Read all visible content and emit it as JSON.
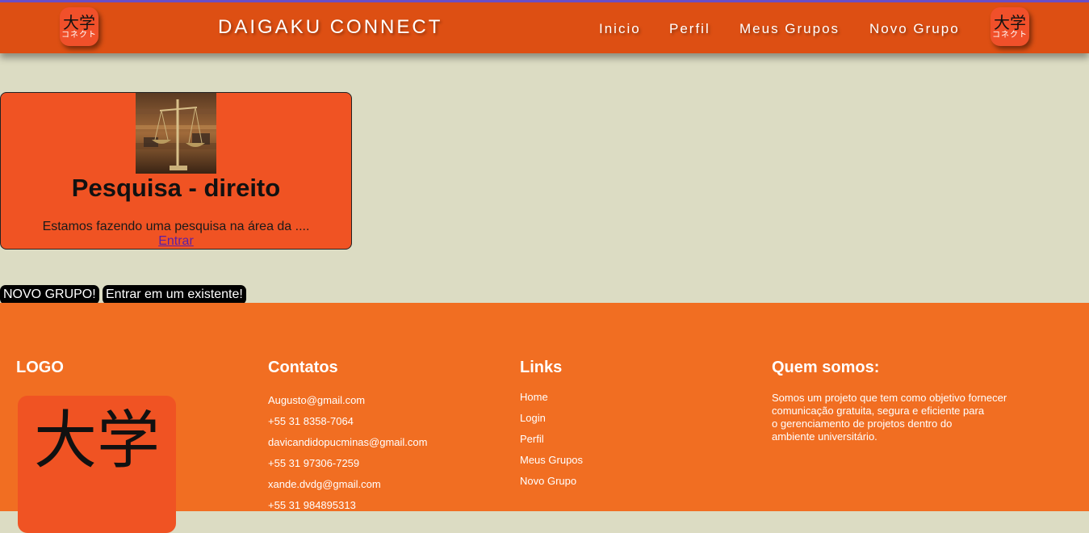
{
  "header": {
    "brand": "DAIGAKU CONNECT",
    "logo_kanji": "大学",
    "logo_kana": "コネクト",
    "nav": [
      "Inicio",
      "Perfil",
      "Meus Grupos",
      "Novo Grupo"
    ]
  },
  "card": {
    "title": "Pesquisa - direito",
    "description": "Estamos fazendo uma pesquisa na área da ....",
    "enter_link": "Entrar"
  },
  "buttons": {
    "new_group": "NOVO GRUPO!",
    "join_existing": "Entrar em um existente!"
  },
  "footer": {
    "logo_heading": "LOGO",
    "contacts_heading": "Contatos",
    "contacts": [
      "Augusto@gmail.com",
      "+55 31 8358-7064",
      "davicandidopucminas@gmail.com",
      "+55 31 97306-7259",
      "xande.dvdg@gmail.com",
      "+55 31 984895313"
    ],
    "links_heading": "Links",
    "links": [
      "Home",
      "Login",
      "Perfil",
      "Meus Grupos",
      "Novo Grupo"
    ],
    "about_heading": "Quem somos:",
    "about_lines": [
      "Somos um projeto que tem como objetivo fornecer",
      "comunicação gratuita, segura e eficiente para",
      "o gerenciamento de projetos dentro do",
      "ambiente universitário."
    ]
  },
  "colors": {
    "header": "#dd4f13",
    "page_bg": "#dcdcc3",
    "card": "#f05323",
    "footer": "#f16e22",
    "accent_line": "#6b4fc8"
  }
}
